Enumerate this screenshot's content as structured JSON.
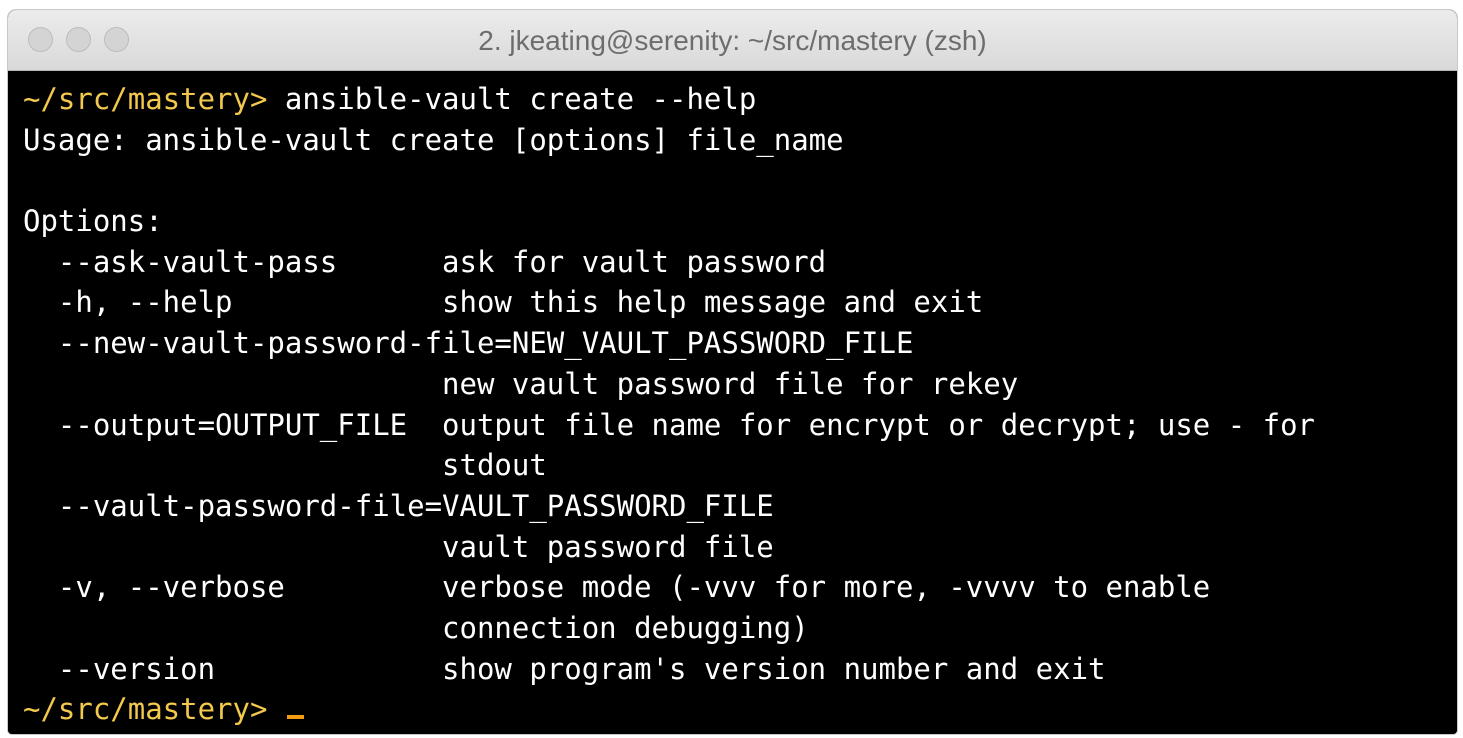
{
  "window": {
    "title": "2. jkeating@serenity: ~/src/mastery (zsh)"
  },
  "terminal": {
    "prompt": "~/src/mastery>",
    "command": " ansible-vault create --help",
    "lines": [
      "Usage: ansible-vault create [options] file_name",
      "",
      "Options:",
      "  --ask-vault-pass      ask for vault password",
      "  -h, --help            show this help message and exit",
      "  --new-vault-password-file=NEW_VAULT_PASSWORD_FILE",
      "                        new vault password file for rekey",
      "  --output=OUTPUT_FILE  output file name for encrypt or decrypt; use - for",
      "                        stdout",
      "  --vault-password-file=VAULT_PASSWORD_FILE",
      "                        vault password file",
      "  -v, --verbose         verbose mode (-vvv for more, -vvvv to enable",
      "                        connection debugging)",
      "  --version             show program's version number and exit"
    ],
    "final_prompt": "~/src/mastery>"
  },
  "colors": {
    "prompt": "#f2c94c",
    "text": "#ffffff",
    "background": "#000000",
    "cursor": "#f39c12"
  }
}
